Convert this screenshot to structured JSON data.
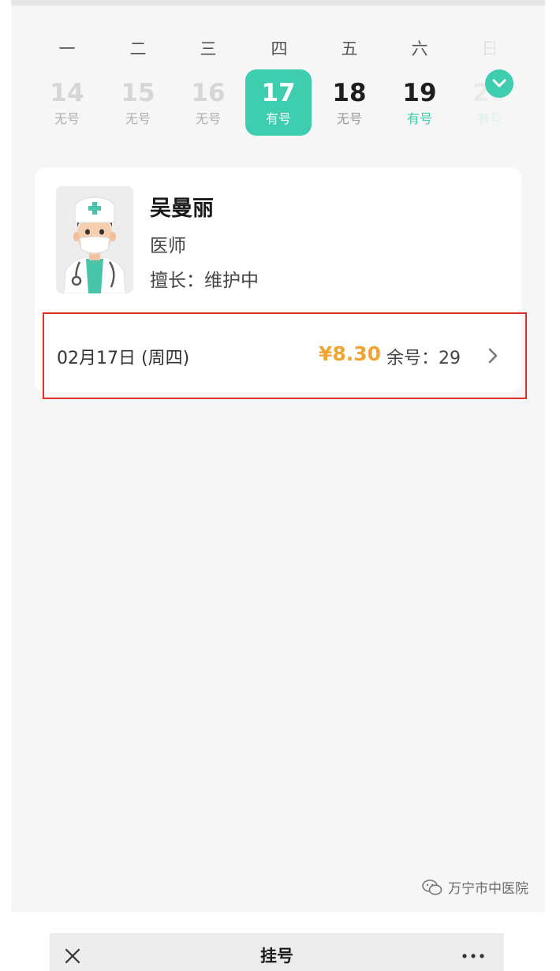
{
  "calendar": {
    "weekdays": [
      "一",
      "二",
      "三",
      "四",
      "五",
      "六",
      "日"
    ],
    "days": [
      {
        "num": "14",
        "status": "无号"
      },
      {
        "num": "15",
        "status": "无号"
      },
      {
        "num": "16",
        "status": "无号"
      },
      {
        "num": "17",
        "status": "有号"
      },
      {
        "num": "18",
        "status": "无号"
      },
      {
        "num": "19",
        "status": "有号"
      },
      {
        "num": "20",
        "status": "有号"
      }
    ],
    "selected_index": 3,
    "accent_color": "#3fcdb0",
    "expand_icon": "chevron-down-icon"
  },
  "doctor": {
    "name": "吴曼丽",
    "title": "医师",
    "specialty": "擅长：维护中"
  },
  "slot": {
    "date": "02月17日 (周四)",
    "price": "¥8.30",
    "remaining": "余号：29",
    "price_color": "#f0a431"
  },
  "watermark": {
    "text": "万宁市中医院"
  },
  "navbar": {
    "title": "挂号",
    "close_icon": "close-icon",
    "more_icon": "more-icon"
  }
}
